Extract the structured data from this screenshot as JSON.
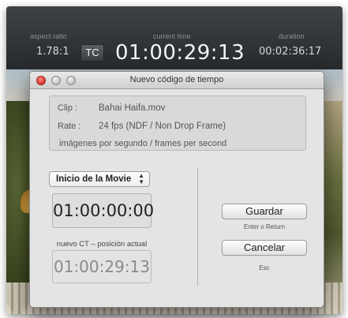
{
  "hud": {
    "aspect_label": "aspect ratio",
    "aspect_value": "1.78:1",
    "tc_button": "TC",
    "current_label": "current time",
    "current_value": "01:00:29:13",
    "duration_label": "duration",
    "duration_value": "00:02:36:17"
  },
  "dialog": {
    "title": "Nuevo código de tiempo",
    "info": {
      "clip_label": "Clip :",
      "clip_value": "Bahai Haifa.mov",
      "rate_label": "Rate :",
      "rate_value": "24  fps (NDF / Non Drop Frame)",
      "fps_desc": "imágenes por segundo / frames per second"
    },
    "select_value": "Inicio de la Movie",
    "timecode_value": "01:00:00:00",
    "new_tc_label": "nuevo CT – posición actual",
    "current_position_value": "01:00:29:13",
    "save_button": "Guardar",
    "save_hint": "Enter  o  Return",
    "cancel_button": "Cancelar",
    "cancel_hint": "Esc"
  },
  "colors": {
    "hud_bg": "#2e3034",
    "dialog_bg": "#e4e4e4",
    "close_red": "#d0342c"
  }
}
